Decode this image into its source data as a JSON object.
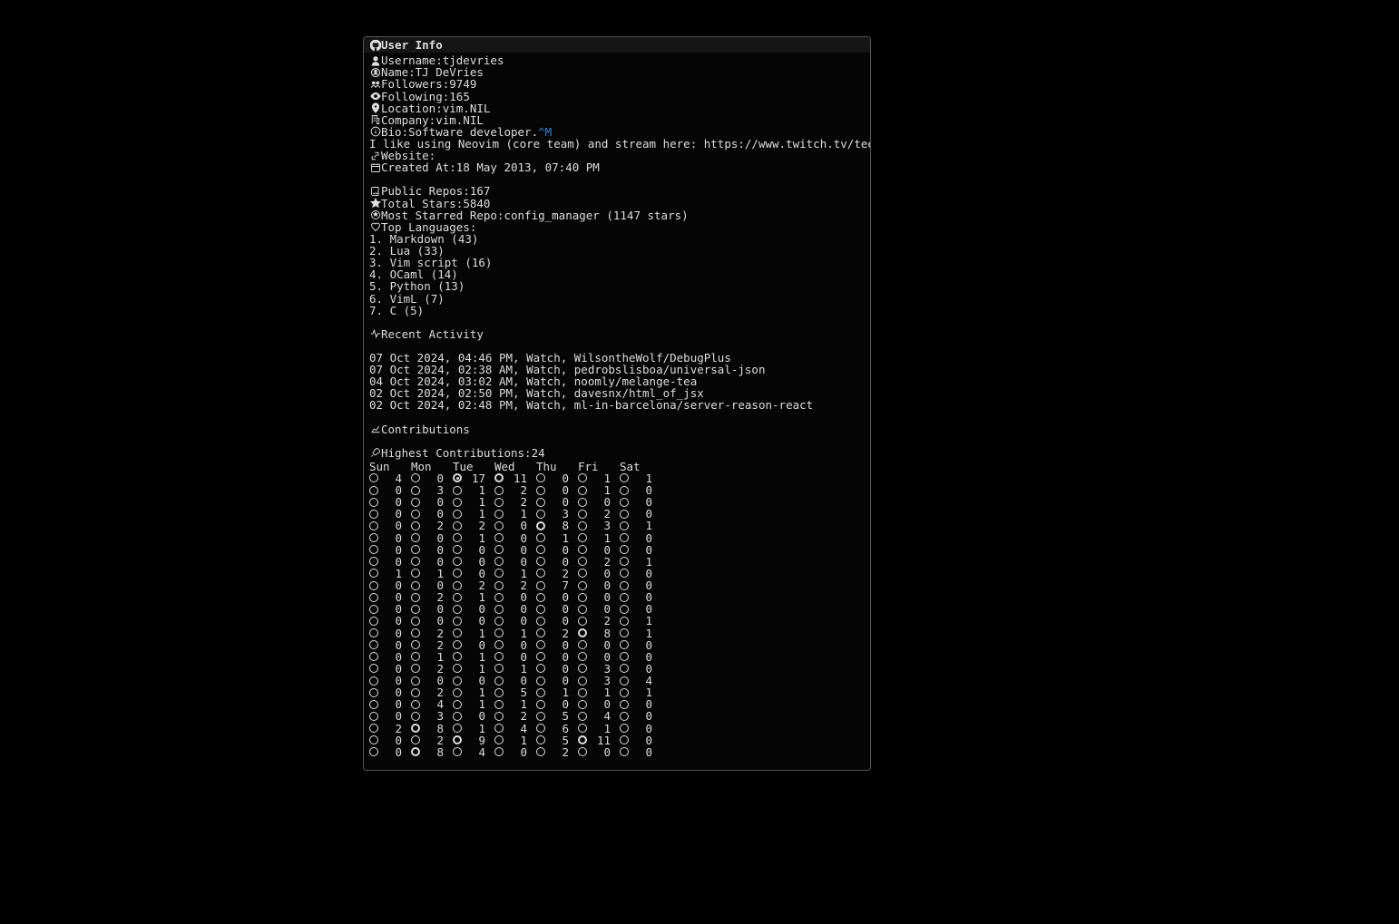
{
  "title": "User Info",
  "info": {
    "username_label": "Username: ",
    "username": "tjdevries",
    "name_label": "Name: ",
    "name": "TJ DeVries",
    "followers_label": "Followers: ",
    "followers": "9749",
    "following_label": "Following: ",
    "following": "165",
    "location_label": "Location: ",
    "location": "vim.NIL",
    "company_label": "Company: ",
    "company": "vim.NIL",
    "bio_label": "Bio: ",
    "bio": "Software developer.",
    "bio_long": "I like using Neovim (core team) and stream here: https://www.twitch.tv/teej_dv",
    "ctrl_m": "^M",
    "website_label": "Website:",
    "created_label": "Created At: ",
    "created": "18 May 2013, 07:40 PM"
  },
  "repos": {
    "public_label": "Public Repos: ",
    "public": "167",
    "stars_label": "Total Stars: ",
    "stars": "5840",
    "most_label": "Most Starred Repo: ",
    "most": "config_manager (1147 stars)",
    "langs_label": "Top Languages:",
    "langs": [
      "1. Markdown (43)",
      "2. Lua (33)",
      "3. Vim script (16)",
      "4. OCaml (14)",
      "5. Python (13)",
      "6. VimL (7)",
      "7. C (5)"
    ]
  },
  "activity": {
    "header": "Recent Activity",
    "items": [
      "07 Oct 2024, 04:46 PM, Watch, WilsontheWolf/DebugPlus",
      "07 Oct 2024, 02:38 AM, Watch, pedrobslisboa/universal-json",
      "04 Oct 2024, 03:02 AM, Watch, noomly/melange-tea",
      "02 Oct 2024, 02:50 PM, Watch, davesnx/html_of_jsx",
      "02 Oct 2024, 02:48 PM, Watch, ml-in-barcelona/server-reason-react"
    ]
  },
  "contrib": {
    "header": "Contributions",
    "highest_label": "Highest Contributions: ",
    "highest": "24",
    "days": [
      "Sun",
      "Mon",
      "Tue",
      "Wed",
      "Thu",
      "Fri",
      "Sat"
    ],
    "rows": [
      [
        4,
        0,
        17,
        11,
        0,
        1,
        1
      ],
      [
        0,
        3,
        1,
        2,
        0,
        1,
        0
      ],
      [
        0,
        0,
        1,
        2,
        0,
        0,
        0
      ],
      [
        0,
        0,
        1,
        1,
        3,
        2,
        0
      ],
      [
        0,
        2,
        2,
        0,
        8,
        3,
        1
      ],
      [
        0,
        0,
        1,
        0,
        1,
        1,
        0
      ],
      [
        0,
        0,
        0,
        0,
        0,
        0,
        0
      ],
      [
        0,
        0,
        0,
        0,
        0,
        2,
        1
      ],
      [
        1,
        1,
        0,
        1,
        2,
        0,
        0
      ],
      [
        0,
        0,
        2,
        2,
        7,
        0,
        0
      ],
      [
        0,
        2,
        1,
        0,
        0,
        0,
        0
      ],
      [
        0,
        0,
        0,
        0,
        0,
        0,
        0
      ],
      [
        0,
        0,
        0,
        0,
        0,
        2,
        1
      ],
      [
        0,
        2,
        1,
        1,
        2,
        8,
        1
      ],
      [
        0,
        2,
        0,
        0,
        0,
        0,
        0
      ],
      [
        0,
        1,
        1,
        0,
        0,
        0,
        0
      ],
      [
        0,
        2,
        1,
        1,
        0,
        3,
        0
      ],
      [
        0,
        0,
        0,
        0,
        0,
        3,
        4
      ],
      [
        0,
        2,
        1,
        5,
        1,
        1,
        1
      ],
      [
        0,
        4,
        1,
        1,
        0,
        0,
        0
      ],
      [
        0,
        3,
        0,
        2,
        5,
        4,
        0
      ],
      [
        2,
        8,
        1,
        4,
        6,
        1,
        0
      ],
      [
        0,
        2,
        9,
        1,
        5,
        11,
        0
      ],
      [
        0,
        8,
        4,
        0,
        2,
        0,
        0
      ]
    ]
  }
}
